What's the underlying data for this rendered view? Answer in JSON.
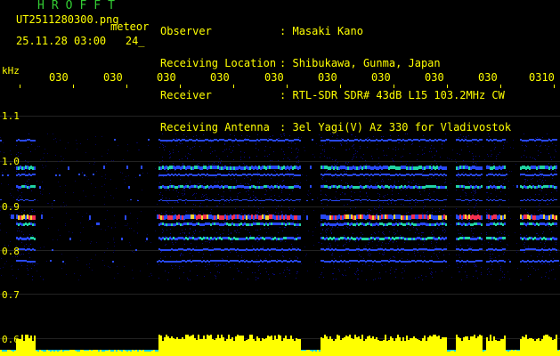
{
  "header": {
    "brand": "HROFFT",
    "filename": "UT2511280300.png",
    "mode": "meteor",
    "date_time": "25.11.28 03:00",
    "number": "24_",
    "fields": [
      {
        "label": "Observer",
        "value": "Masaki Kano"
      },
      {
        "label": "Receiving Location",
        "value": "Shibukawa, Gunma, Japan"
      },
      {
        "label": "Receiver",
        "value": "RTL-SDR SDR# 43dB L15 103.2MHz CW"
      },
      {
        "label": "Receiving Antenna",
        "value": "3el Yagi(V) Az 330 for Vladivostok"
      }
    ],
    "separator": ":"
  },
  "axis": {
    "unit": "kHz",
    "y_ticks": [
      "1.1",
      "1.0",
      "0.9",
      "0.8",
      "0.7",
      "0.6"
    ],
    "x_ticks": [
      "030",
      "030",
      "030",
      "030",
      "030",
      "030",
      "030",
      "030",
      "030",
      "0310"
    ]
  },
  "colors": {
    "background": "#000000",
    "text": "#ffff00",
    "brand": "#33cc33",
    "header_values": "#ffffff",
    "noise": "#0a0a8c",
    "signal_low": "#2a4cff",
    "signal_mid": "#22ddaa",
    "signal_high": "#ff3355",
    "power_trace": "#ffff00",
    "power_base": "#00ccff"
  }
}
